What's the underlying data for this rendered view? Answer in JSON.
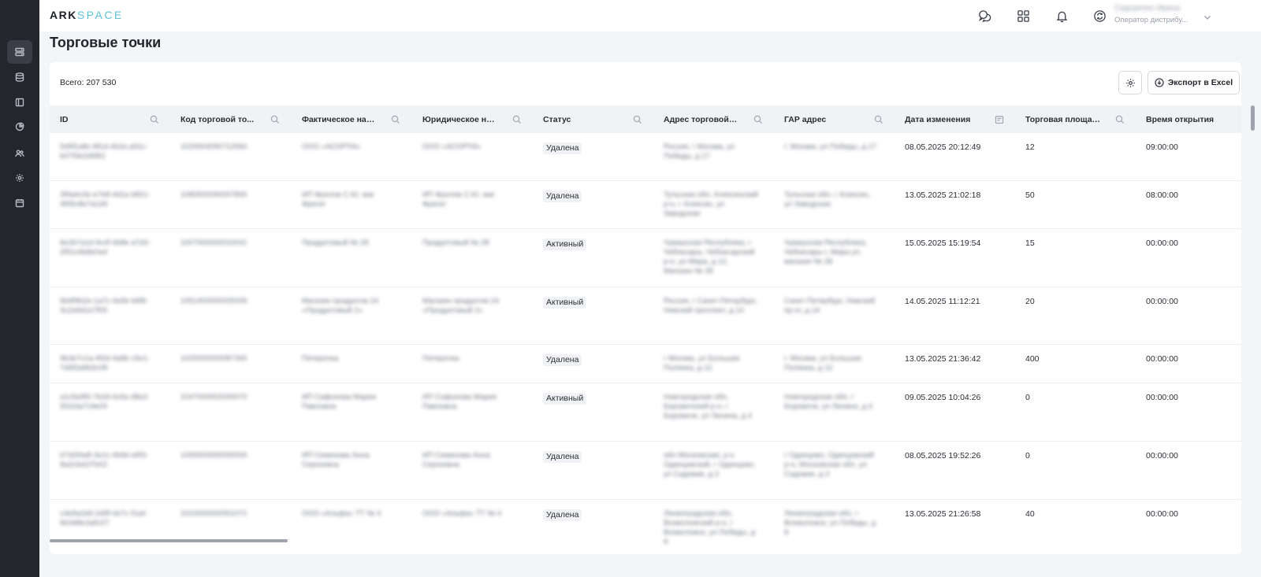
{
  "app": {
    "logo_bold": "ARK",
    "logo_light": "SPACE"
  },
  "topbar": {
    "icons": [
      "chat-icon",
      "apps-grid-icon",
      "bell-icon",
      "sync-icon"
    ],
    "user_name": "Сидоренко Ирина",
    "user_role": "Оператор дистрибу..."
  },
  "sidebar": {
    "items": [
      "list-icon",
      "database-icon",
      "book-icon",
      "pie-chart-icon",
      "users-icon",
      "gear-icon",
      "calendar-icon"
    ]
  },
  "page": {
    "title": "Торговые точки",
    "total_label": "Всего: 207 530",
    "export_label": "Экспорт в Excel"
  },
  "table": {
    "columns": [
      {
        "label": "ID",
        "icon": "search-icon"
      },
      {
        "label": "Код торговой то...",
        "icon": "search-icon"
      },
      {
        "label": "Фактическое наз...",
        "icon": "search-icon"
      },
      {
        "label": "Юридическое наз...",
        "icon": "search-icon"
      },
      {
        "label": "Статус",
        "icon": "search-icon"
      },
      {
        "label": "Адрес торговой т...",
        "icon": "search-icon"
      },
      {
        "label": "ГАР адрес",
        "icon": "search-icon"
      },
      {
        "label": "Дата изменения",
        "icon": "calendar-icon"
      },
      {
        "label": "Торговая площад...",
        "icon": "search-icon"
      },
      {
        "label": "Время открытия",
        "icon": ""
      }
    ],
    "rows": [
      {
        "id": "5d9f1a8c-8f1d-4b2a a91c-b07f3e2d5f61",
        "code": "1020004090712560",
        "fact": "ООО «АСОРТИ»",
        "legal": "ООО «АСОРТИ»",
        "status": "Удалена",
        "addr": "Россия, г Москва, ул Победы, д 17",
        "gar": "г. Москва, ул Победы, д 17",
        "date": "08.05.2025 20:12:49",
        "area": "12",
        "time": "09:00:00"
      },
      {
        "id": "3f9a4c0e-e7b8-4d1a b821-4f05c8e7a1d9",
        "code": "1080500090007800",
        "fact": "ИП Фролов С.Ю. маг Фрегат",
        "legal": "ИП Фролов С.Ю. маг Фрегат",
        "status": "Удалена",
        "addr": "Тульская обл, Алексинский р-н, г Алексин, ул Заводская",
        "gar": "Тульская обл, г Алексин, ул Заводская",
        "date": "13.05.2025 21:02:18",
        "area": "50",
        "time": "08:00:00"
      },
      {
        "id": "6e2b7a1d-9c4f-4b8e a7d3-2f91c6b8e0a4",
        "code": "1007000000010041",
        "fact": "Продуктовый № 28",
        "legal": "Продуктовый № 28",
        "status": "Активный",
        "addr": "Чувашская Республика, г Чебоксары, Чебоксарский р-н, ул Мира, д 12, Магазин № 28",
        "gar": "Чувашская Республика, Чебоксары г, Мира ул, магазин № 28",
        "date": "15.05.2025 15:19:54",
        "area": "15",
        "time": "00:00:00"
      },
      {
        "id": "8d4f9b2e-1a7c-4e5b b6f8-3c2a9d1e7f05",
        "code": "1051400000005005",
        "fact": "Магазин продуктов 24 «Продуктовый 2»",
        "legal": "Магазин продуктов 24 «Продуктовый 2»",
        "status": "Активный",
        "addr": "Россия, г Санкт-Петербург, Невский проспект, д 14",
        "gar": "Санкт-Петербург, Невский пр-кт, д 14",
        "date": "14.05.2025 11:12:21",
        "area": "20",
        "time": "00:00:00"
      },
      {
        "id": "9b3e7c1a-4f2d-4a8b c5e1-7d6f2a9b3c08",
        "code": "1020000000087300",
        "fact": "Пятерочка",
        "legal": "Пятерочка",
        "status": "Удалена",
        "addr": "г Москва, ул Большая Полянка, д 12",
        "gar": "г. Москва, ул Большая Полянка, д 12",
        "date": "13.05.2025 21:36:42",
        "area": "400",
        "time": "00:00:00"
      },
      {
        "id": "a1c5e9f3-7b2d-4c6a d8e2-5f1b3a7c9e04",
        "code": "1047000002000070",
        "fact": "ИП Сафонова Мария Павловна",
        "legal": "ИП Сафонова Мария Павловна",
        "status": "Активный",
        "addr": "Новгородская обл, Боровичский р-н, г Боровичи, ул Ленина, д 4",
        "gar": "Новгородская обл, г Боровичи, ул Ленина, д 4",
        "date": "09.05.2025 10:04:26",
        "area": "0",
        "time": "00:00:00"
      },
      {
        "id": "b7d2f4a8-3e1c-4b9d e6f3-8a2c5d1f7b02",
        "code": "1000000000000000",
        "fact": "ИП Семенова Анна Сергеевна",
        "legal": "ИП Семенова Анна Сергеевна",
        "status": "Удалена",
        "addr": "обл Московская, р-н Одинцовский, г Одинцово, ул Садовая, д 3",
        "gar": "г Одинцово, Одинцовский р-н, Московская обл, ул Садовая, д 3",
        "date": "08.05.2025 19:52:26",
        "area": "0",
        "time": "00:00:00"
      },
      {
        "id": "c4e8a1b6-2d9f-4e7c f1a4-6b3d8e2a5c07",
        "code": "1010000000051071",
        "fact": "ООО «Альфа» ТТ № 4",
        "legal": "ООО «Альфа» ТТ № 4",
        "status": "Удалена",
        "addr": "Ленинградская обл, Всеволожский р-н, г Всеволожск, ул Победы, д 8",
        "gar": "Ленинградская обл, г Всеволожск, ул Победы, д 8",
        "date": "13.05.2025 21:26:58",
        "area": "40",
        "time": "00:00:00"
      }
    ]
  }
}
